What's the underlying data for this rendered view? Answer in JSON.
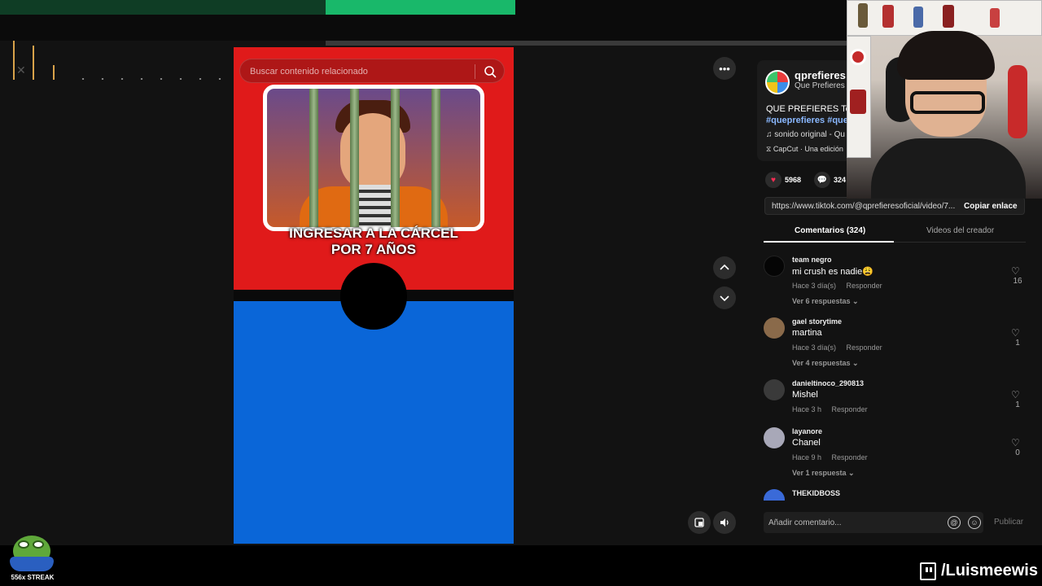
{
  "search": {
    "placeholder": "Buscar contenido relacionado"
  },
  "video": {
    "caption_line1": "INGRESAR A LA CÁRCEL",
    "caption_line2": "POR 7 AÑOS"
  },
  "post": {
    "author": "qprefieres",
    "author_sub": "Que Prefieres ·",
    "description": "QUE PREFIERES Ten",
    "tags": "#queprefieres #que",
    "sound": "sonido original - Qu",
    "capcut": "CapCut · Una edición"
  },
  "stats": {
    "likes": "5968",
    "comments": "324"
  },
  "link": {
    "url": "https://www.tiktok.com/@qprefieresoficial/video/7...",
    "copy_label": "Copiar enlace"
  },
  "tabs": [
    {
      "label": "Comentarios (324)"
    },
    {
      "label": "Videos del creador"
    }
  ],
  "reply_label": "Responder",
  "comments": [
    {
      "user": "team negro",
      "text": "mi crush es nadie😩",
      "time": "Hace 3 día(s)",
      "likes": "16",
      "more": "Ver 6 respuestas ⌄",
      "avatar_color": "#050505"
    },
    {
      "user": "gael storytime",
      "text": "martina",
      "time": "Hace 3 día(s)",
      "likes": "1",
      "more": "Ver 4 respuestas ⌄",
      "avatar_color": "#8a6a4a"
    },
    {
      "user": "danieltinoco_290813",
      "text": "Mishel",
      "time": "Hace 3 h",
      "likes": "1",
      "more": "",
      "avatar_color": "#3a3a3a"
    },
    {
      "user": "layanore",
      "text": "Chanel",
      "time": "Hace 9 h",
      "likes": "0",
      "more": "Ver 1 respuesta ⌄",
      "avatar_color": "#a8a8b8"
    },
    {
      "user": "THEKIDBOSS",
      "text": "",
      "time": "",
      "likes": "",
      "more": "",
      "avatar_color": "#3a6ad8"
    }
  ],
  "comment_input": {
    "placeholder": "Añadir comentario..."
  },
  "publish_label": "Publicar",
  "streak_label": "556x STREAK",
  "channel_handle": "/Luismeewis",
  "colors": {
    "video_red": "#e01a1a",
    "video_blue": "#0a66d8",
    "like_heart": "#fe2c55",
    "accent_green": "#19b86a"
  }
}
